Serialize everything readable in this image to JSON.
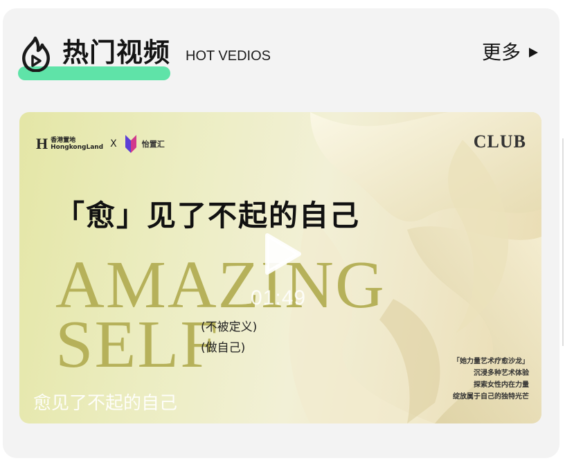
{
  "section": {
    "title": "热门视频",
    "subtitle": "HOT VEDIOS",
    "more_label": "更多"
  },
  "icons": {
    "title_icon": "fire-play-icon",
    "more_icon": "play-triangle-icon",
    "video_play_icon": "play-icon"
  },
  "colors": {
    "accent": "#5fe3a8",
    "headline_gold": "#b6b15a",
    "card_bg": "#f3f3f3"
  },
  "video": {
    "brand_left": "香港置地",
    "brand_left_en": "HongkongLand",
    "brand_x": "X",
    "brand_right": "怡置汇",
    "club_logo": "CLUB",
    "heading": "「愈」见了不起的自己",
    "headline_line1": "AMAZING",
    "headline_line2": "SELF",
    "tagline_line1": "(不被定义)",
    "tagline_line2": "(做自己)",
    "side_lines": [
      "「她力量艺术疗愈沙龙」",
      "沉浸多种艺术体验",
      "探索女性内在力量",
      "绽放属于自己的独特光芒"
    ],
    "duration": "01:49",
    "caption": "愈见了不起的自己"
  }
}
